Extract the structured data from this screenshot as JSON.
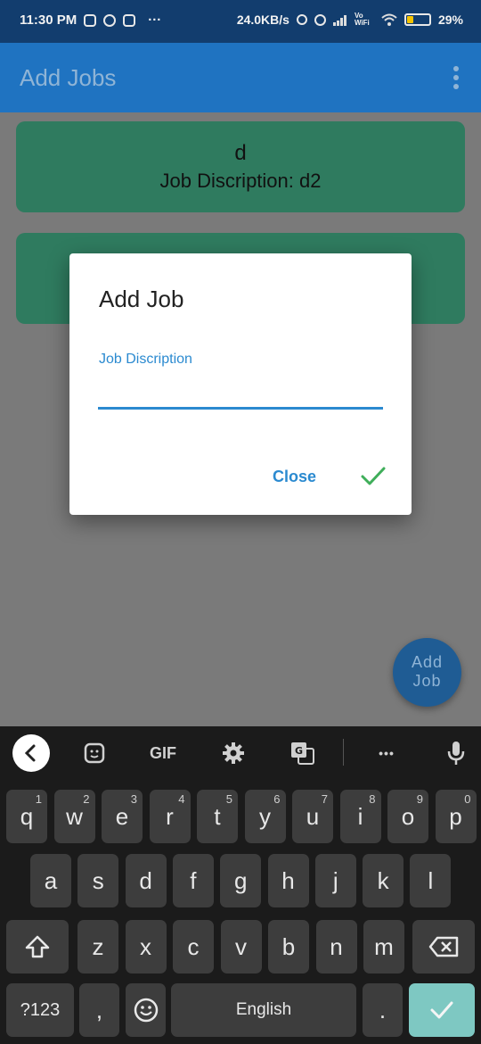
{
  "status_bar": {
    "time": "11:30 PM",
    "dots": "···",
    "speed": "24.0KB/s",
    "vowifi": "Vo WiFi",
    "battery": "29%",
    "battery_level": 0.29
  },
  "app_bar": {
    "title": "Add Jobs"
  },
  "cards": [
    {
      "title": "d",
      "description": "Job Discription: d2"
    },
    {
      "title": "",
      "description": ""
    }
  ],
  "fab": {
    "line1": "Add",
    "line2": "Job"
  },
  "dialog": {
    "title": "Add Job",
    "field_label": "Job Discription",
    "field_value": "",
    "close_label": "Close",
    "confirm_icon": "check-icon"
  },
  "keyboard": {
    "toolbar": {
      "gif_label": "GIF",
      "more_label": "•••"
    },
    "rows": [
      [
        {
          "k": "q",
          "h": "1"
        },
        {
          "k": "w",
          "h": "2"
        },
        {
          "k": "e",
          "h": "3"
        },
        {
          "k": "r",
          "h": "4"
        },
        {
          "k": "t",
          "h": "5"
        },
        {
          "k": "y",
          "h": "6"
        },
        {
          "k": "u",
          "h": "7"
        },
        {
          "k": "i",
          "h": "8"
        },
        {
          "k": "o",
          "h": "9"
        },
        {
          "k": "p",
          "h": "0"
        }
      ],
      [
        {
          "k": "a"
        },
        {
          "k": "s"
        },
        {
          "k": "d"
        },
        {
          "k": "f"
        },
        {
          "k": "g"
        },
        {
          "k": "h"
        },
        {
          "k": "j"
        },
        {
          "k": "k"
        },
        {
          "k": "l"
        }
      ],
      [
        {
          "k": "z"
        },
        {
          "k": "x"
        },
        {
          "k": "c"
        },
        {
          "k": "v"
        },
        {
          "k": "b"
        },
        {
          "k": "n"
        },
        {
          "k": "m"
        }
      ]
    ],
    "symbols_label": "?123",
    "comma_label": ",",
    "space_label": "English",
    "period_label": "."
  },
  "colors": {
    "app_bar": "#1f73c1",
    "card": "#2f7b5f",
    "accent": "#2b8ad0",
    "confirm": "#3fae5a",
    "enter_key": "#7ec8c2"
  }
}
